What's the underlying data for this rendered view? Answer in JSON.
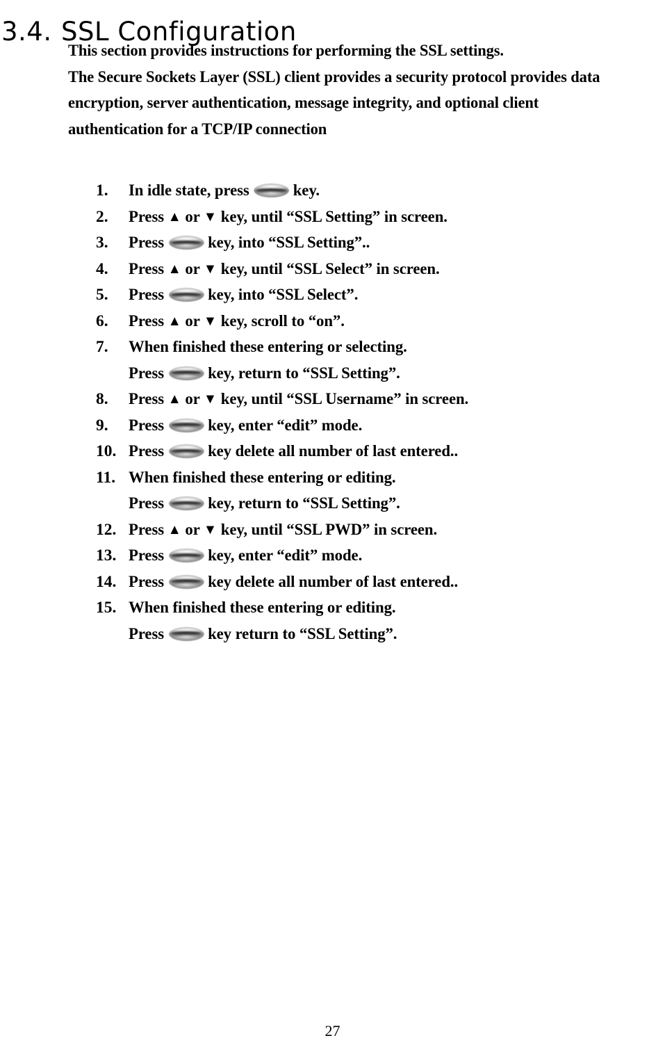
{
  "document": {
    "heading": {
      "number": "3.4.",
      "title": "SSL Configuration"
    },
    "intro_lines": [
      "This section provides instructions for performing the SSL settings.",
      "The Secure Sockets Layer (SSL) client provides a security protocol provides data",
      "encryption, server authentication, message integrity, and optional client",
      "authentication for a TCP/IP connection"
    ],
    "steps": [
      {
        "number": "1.",
        "before": "In idle state, press",
        "icon": "key-button-icon",
        "after": "key."
      },
      {
        "number": "2.",
        "before": "Press ▲ or ▼ key, until “SSL Setting” in screen.",
        "icon": "",
        "after": ""
      },
      {
        "number": "3.",
        "before": "Press",
        "icon": "key-button-icon",
        "after": "key, into “SSL Setting”.."
      },
      {
        "number": "4.",
        "before": "Press ▲ or ▼ key, until “SSL Select” in screen.",
        "icon": "",
        "after": ""
      },
      {
        "number": "5.",
        "before": "Press",
        "icon": "key-button-icon",
        "after": "key, into “SSL Select”."
      },
      {
        "number": "6.",
        "before": "Press ▲ or ▼ key, scroll to “on”.",
        "icon": "",
        "after": ""
      },
      {
        "number": "7.",
        "before": "When finished these entering or selecting.",
        "icon": "",
        "after": ""
      },
      {
        "number": "",
        "continuation": true,
        "before": "Press",
        "icon": "key-button-icon",
        "after": "key, return to “SSL Setting”."
      },
      {
        "number": "8.",
        "before": "Press ▲ or ▼ key, until “SSL Username” in screen.",
        "icon": "",
        "after": ""
      },
      {
        "number": "9.",
        "before": "Press",
        "icon": "key-button-icon",
        "after": "key, enter “edit” mode."
      },
      {
        "number": "10.",
        "before": "Press",
        "icon": "key-button-icon",
        "after": "key delete all number of last entered.."
      },
      {
        "number": "11.",
        "before": "When finished these entering or editing.",
        "icon": "",
        "after": ""
      },
      {
        "number": "",
        "continuation": true,
        "before": "Press",
        "icon": "key-button-icon",
        "after": "key, return to “SSL Setting”."
      },
      {
        "number": "12.",
        "before": "Press ▲ or ▼ key, until “SSL PWD” in screen.",
        "icon": "",
        "after": ""
      },
      {
        "number": "13.",
        "before": "Press",
        "icon": "key-button-icon",
        "after": "key, enter “edit” mode."
      },
      {
        "number": "14.",
        "before": "Press",
        "icon": "key-button-icon",
        "after": "key delete all number of last entered.."
      },
      {
        "number": "15.",
        "before": "When finished these entering or editing.",
        "icon": "",
        "after": ""
      },
      {
        "number": "",
        "continuation": true,
        "before": "Press",
        "icon": "key-button-icon",
        "after": "key return to “SSL Setting”."
      }
    ],
    "footer": {
      "page_number": "27"
    },
    "colors": {
      "text": "#000000",
      "background": "#ffffff"
    }
  }
}
